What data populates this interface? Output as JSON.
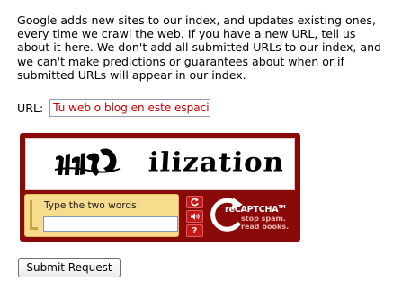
{
  "intro": {
    "text": "Google adds new sites to our index, and updates existing ones, every time we crawl the web. If you have a new URL, tell us about it here. We don't add all submitted URLs to our index, and we can't make predictions or guarantees about when or if submitted URLs will appear in our index."
  },
  "url_field": {
    "label": "URL:",
    "placeholder": "Tu web o blog en este espacio",
    "value": "",
    "text_color": "#c00000"
  },
  "recaptcha": {
    "challenge_word_right": "ilization",
    "answer_label": "Type the two words:",
    "answer_value": "",
    "reload_icon": "reload-icon",
    "audio_icon": "audio-icon",
    "help_icon": "help-icon",
    "help_glyph": "?",
    "brand_prefix": "re",
    "brand_name": "CAPTCHA",
    "brand_tm": "TM",
    "tagline_line1": "stop spam.",
    "tagline_line2": "read books.",
    "frame_color": "#8a0a0a",
    "answer_bg": "#f6dc8c"
  },
  "submit": {
    "label": "Submit Request"
  }
}
